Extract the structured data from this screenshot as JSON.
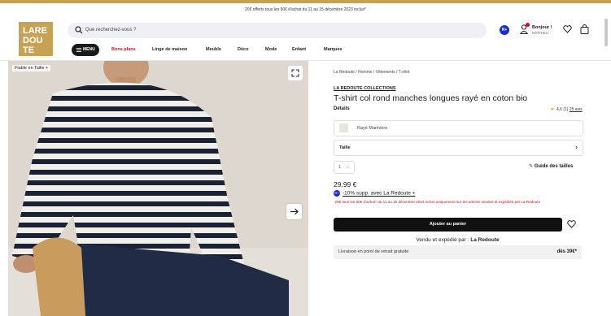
{
  "promo_banner": "20€ offerts tous les 50€ d'achat du 11 au 15 décembre 2023 inclus*",
  "logo": {
    "text": "LA REDOUTE"
  },
  "search": {
    "placeholder": "Que recherchez-vous ?"
  },
  "account": {
    "badge": "R+",
    "greeting": "Bonjour !",
    "name": "MATHIEU"
  },
  "nav": {
    "menu_label": "MENU",
    "items": [
      "Bons plans",
      "Linge de maison",
      "Meuble",
      "Déco",
      "Mode",
      "Enfant",
      "Marques"
    ]
  },
  "gallery": {
    "fit_label": "Fiable en Taille +"
  },
  "product": {
    "breadcrumb": "La Redoute / Homme / Vêtements / T-shirt",
    "brand": "LA REDOUTE COLLECTIONS",
    "title": "T-shirt col rond manches longues rayé en coton bio",
    "details_label": "Détails",
    "rating": "4,6 (1)",
    "reviews_link": "25 avis",
    "color": "Rayé Marinière",
    "size_label": "Taille",
    "quantity": "1",
    "size_guide": "Guide des tailles",
    "price": "29,99 €",
    "rplus_badge": "R+",
    "rplus_offer": "-10% supp. avec La Redoute +",
    "promo_text": "-20€ tous les 50€ d'achat* du 11 au 15 décembre 2023 inclus uniquement sur les articles vendus et expédiés par La Redoute",
    "add_to_cart": "Ajouter au panier",
    "sold_by_prefix": "Vendu et expédié par :",
    "sold_by": "La Redoute",
    "delivery_label": "Livraison en point de retrait gratuite",
    "delivery_threshold": "dès 39€*"
  },
  "colors": {
    "gold": "#c8a253",
    "red": "#e3002b",
    "blue": "#1d2bd4",
    "dark": "#111111"
  }
}
